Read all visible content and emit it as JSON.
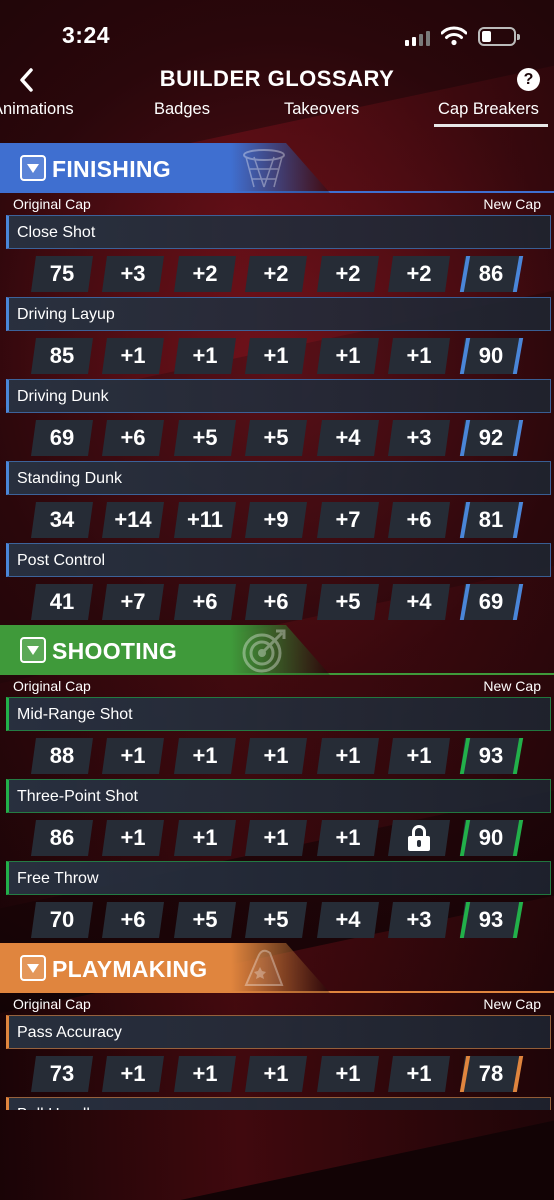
{
  "status_bar": {
    "time": "3:24"
  },
  "header": {
    "title": "BUILDER GLOSSARY",
    "help_label": "?"
  },
  "tabs": [
    {
      "label": "Animations",
      "active": false
    },
    {
      "label": "Badges",
      "active": false
    },
    {
      "label": "Takeovers",
      "active": false
    },
    {
      "label": "Cap Breakers",
      "active": true
    }
  ],
  "cap_labels": {
    "original": "Original Cap",
    "new": "New Cap"
  },
  "sections": [
    {
      "title": "FINISHING",
      "color": "#3f6fd0",
      "accent": "#4a86d8",
      "emblem": "basketball-hoop-icon",
      "attributes": [
        {
          "name": "Close Shot",
          "original": "75",
          "boosts": [
            "+3",
            "+2",
            "+2",
            "+2",
            "+2"
          ],
          "new": "86"
        },
        {
          "name": "Driving Layup",
          "original": "85",
          "boosts": [
            "+1",
            "+1",
            "+1",
            "+1",
            "+1"
          ],
          "new": "90"
        },
        {
          "name": "Driving Dunk",
          "original": "69",
          "boosts": [
            "+6",
            "+5",
            "+5",
            "+4",
            "+3"
          ],
          "new": "92"
        },
        {
          "name": "Standing Dunk",
          "original": "34",
          "boosts": [
            "+14",
            "+11",
            "+9",
            "+7",
            "+6"
          ],
          "new": "81"
        },
        {
          "name": "Post Control",
          "original": "41",
          "boosts": [
            "+7",
            "+6",
            "+6",
            "+5",
            "+4"
          ],
          "new": "69"
        }
      ]
    },
    {
      "title": "SHOOTING",
      "color": "#3f9a3a",
      "accent": "#22b04a",
      "emblem": "target-icon",
      "attributes": [
        {
          "name": "Mid-Range Shot",
          "original": "88",
          "boosts": [
            "+1",
            "+1",
            "+1",
            "+1",
            "+1"
          ],
          "new": "93"
        },
        {
          "name": "Three-Point Shot",
          "original": "86",
          "boosts": [
            "+1",
            "+1",
            "+1",
            "+1",
            "LOCKED"
          ],
          "new": "90"
        },
        {
          "name": "Free Throw",
          "original": "70",
          "boosts": [
            "+6",
            "+5",
            "+5",
            "+4",
            "+3"
          ],
          "new": "93"
        }
      ]
    },
    {
      "title": "PLAYMAKING",
      "color": "#e0853e",
      "accent": "#e0853e",
      "emblem": "wizard-hat-icon",
      "attributes": [
        {
          "name": "Pass Accuracy",
          "original": "73",
          "boosts": [
            "+1",
            "+1",
            "+1",
            "+1",
            "+1"
          ],
          "new": "78"
        },
        {
          "name": "Ball Handle",
          "original": "",
          "boosts": [
            "",
            "",
            "",
            "",
            ""
          ],
          "new": ""
        }
      ]
    }
  ]
}
